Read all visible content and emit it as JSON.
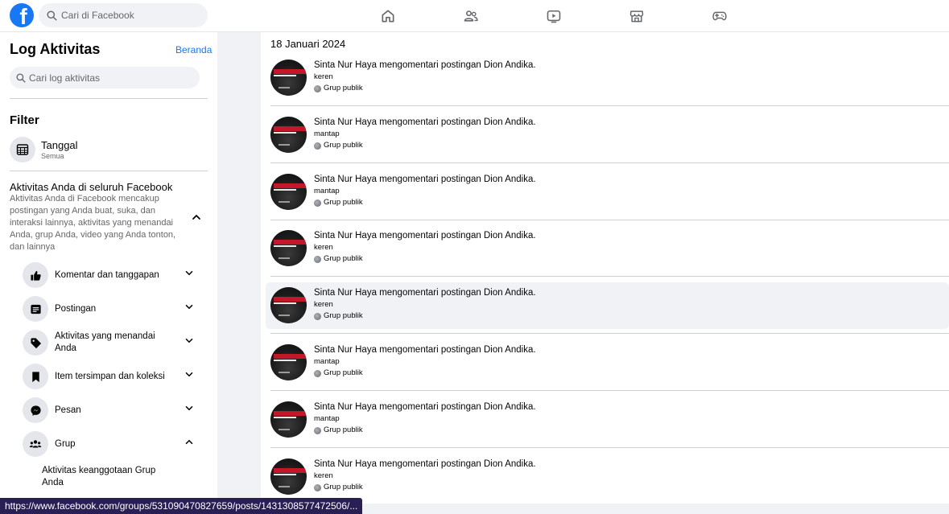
{
  "app": {
    "logo_letter": "f",
    "brand_color": "#1877f2"
  },
  "search": {
    "placeholder": "Cari di Facebook"
  },
  "nav": [
    "home-icon",
    "friends-icon",
    "watch-icon",
    "marketplace-icon",
    "gaming-icon"
  ],
  "sidebar": {
    "title": "Log Aktivitas",
    "home_link": "Beranda",
    "search_placeholder": "Cari log aktivitas",
    "filter_title": "Filter",
    "date_filter": {
      "label": "Tanggal",
      "value": "Semua"
    },
    "all_activity": {
      "heading": "Aktivitas Anda di seluruh Facebook",
      "description": "Aktivitas Anda di Facebook mencakup postingan yang Anda buat, suka, dan interaksi lainnya, aktivitas yang menandai Anda, grup Anda, video yang Anda tonton, dan lainnya"
    },
    "categories": [
      {
        "label": "Komentar dan tanggapan",
        "icon": "thumbs-up-icon",
        "expanded": false
      },
      {
        "label": "Postingan",
        "icon": "post-icon",
        "expanded": false
      },
      {
        "label": "Aktivitas yang menandai Anda",
        "icon": "tag-icon",
        "expanded": false
      },
      {
        "label": "Item tersimpan dan koleksi",
        "icon": "bookmark-icon",
        "expanded": false
      },
      {
        "label": "Pesan",
        "icon": "messenger-icon",
        "expanded": false
      },
      {
        "label": "Grup",
        "icon": "group-icon",
        "expanded": true
      }
    ],
    "sub_item": "Aktivitas keanggotaan Grup Anda"
  },
  "main": {
    "date_heading": "18 Januari 2024",
    "entries": [
      {
        "actor": "Sinta Nur Haya",
        "verb": "mengomentari postingan",
        "target": "Dion Andika",
        "comment": "keren",
        "audience": "Grup publik"
      },
      {
        "actor": "Sinta Nur Haya",
        "verb": "mengomentari postingan",
        "target": "Dion Andika",
        "comment": "mantap",
        "audience": "Grup publik"
      },
      {
        "actor": "Sinta Nur Haya",
        "verb": "mengomentari postingan",
        "target": "Dion Andika",
        "comment": "mantap",
        "audience": "Grup publik"
      },
      {
        "actor": "Sinta Nur Haya",
        "verb": "mengomentari postingan",
        "target": "Dion Andika",
        "comment": "keren",
        "audience": "Grup publik"
      },
      {
        "actor": "Sinta Nur Haya",
        "verb": "mengomentari postingan",
        "target": "Dion Andika",
        "comment": "keren",
        "audience": "Grup publik"
      },
      {
        "actor": "Sinta Nur Haya",
        "verb": "mengomentari postingan",
        "target": "Dion Andika",
        "comment": "mantap",
        "audience": "Grup publik"
      },
      {
        "actor": "Sinta Nur Haya",
        "verb": "mengomentari postingan",
        "target": "Dion Andika",
        "comment": "mantap",
        "audience": "Grup publik"
      },
      {
        "actor": "Sinta Nur Haya",
        "verb": "mengomentari postingan",
        "target": "Dion Andika",
        "comment": "keren",
        "audience": "Grup publik"
      }
    ]
  },
  "status_url": "https://www.facebook.com/groups/531090470827659/posts/1431308577472506/..."
}
